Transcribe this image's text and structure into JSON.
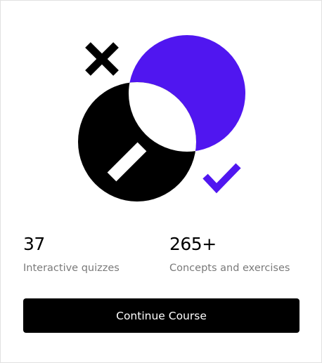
{
  "illustration": {
    "icon_names": [
      "close-icon",
      "magnifier-icon",
      "checkmark-icon"
    ],
    "colors": {
      "accent": "#5016f0",
      "ink": "#000000",
      "paper": "#ffffff"
    }
  },
  "stats": [
    {
      "value": "37",
      "label": "Interactive quizzes"
    },
    {
      "value": "265+",
      "label": "Concepts and exercises"
    }
  ],
  "cta": {
    "label": "Continue Course",
    "background": "#000000",
    "text_color": "#ffffff"
  }
}
